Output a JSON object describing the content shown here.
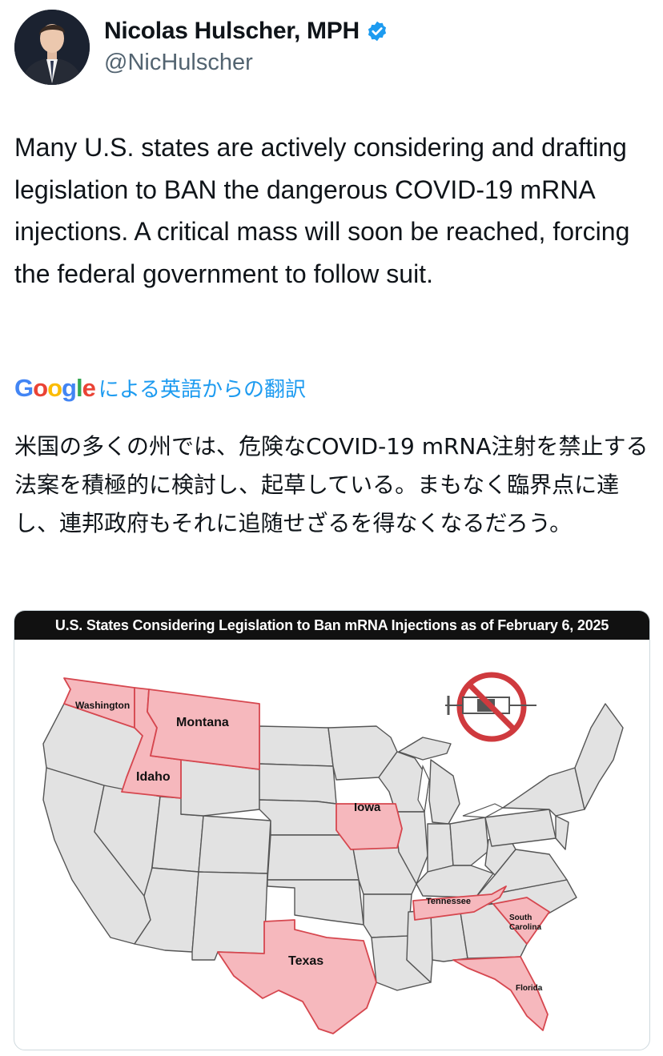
{
  "author": {
    "name": "Nicolas Hulscher, MPH",
    "handle": "@NicHulscher",
    "verified": true,
    "verified_color": "#1d9bf0"
  },
  "tweet": {
    "text": "Many U.S. states are actively considering and drafting legislation to BAN the dangerous COVID-19 mRNA injections. A critical mass will soon be reached, forcing the federal government to follow suit."
  },
  "translation": {
    "provider": "Google",
    "label": "による英語からの翻訳",
    "text": "米国の多くの州では、危険なCOVID-19 mRNA注射を禁止する法案を積極的に検討し、起草している。まもなく臨界点に達し、連邦政府もそれに追随せざるを得なくなるだろう。",
    "link_color": "#1d9bf0"
  },
  "map": {
    "title": "U.S. States Considering Legislation to Ban mRNA Injections as of February 6, 2025",
    "highlight_color": "#f6b8bd",
    "states": {
      "washington": "Washington",
      "montana": "Montana",
      "idaho": "Idaho",
      "iowa": "Iowa",
      "tennessee": "Tennessee",
      "south_carolina_1": "South",
      "south_carolina_2": "Carolina",
      "texas": "Texas",
      "florida": "Florida"
    }
  }
}
